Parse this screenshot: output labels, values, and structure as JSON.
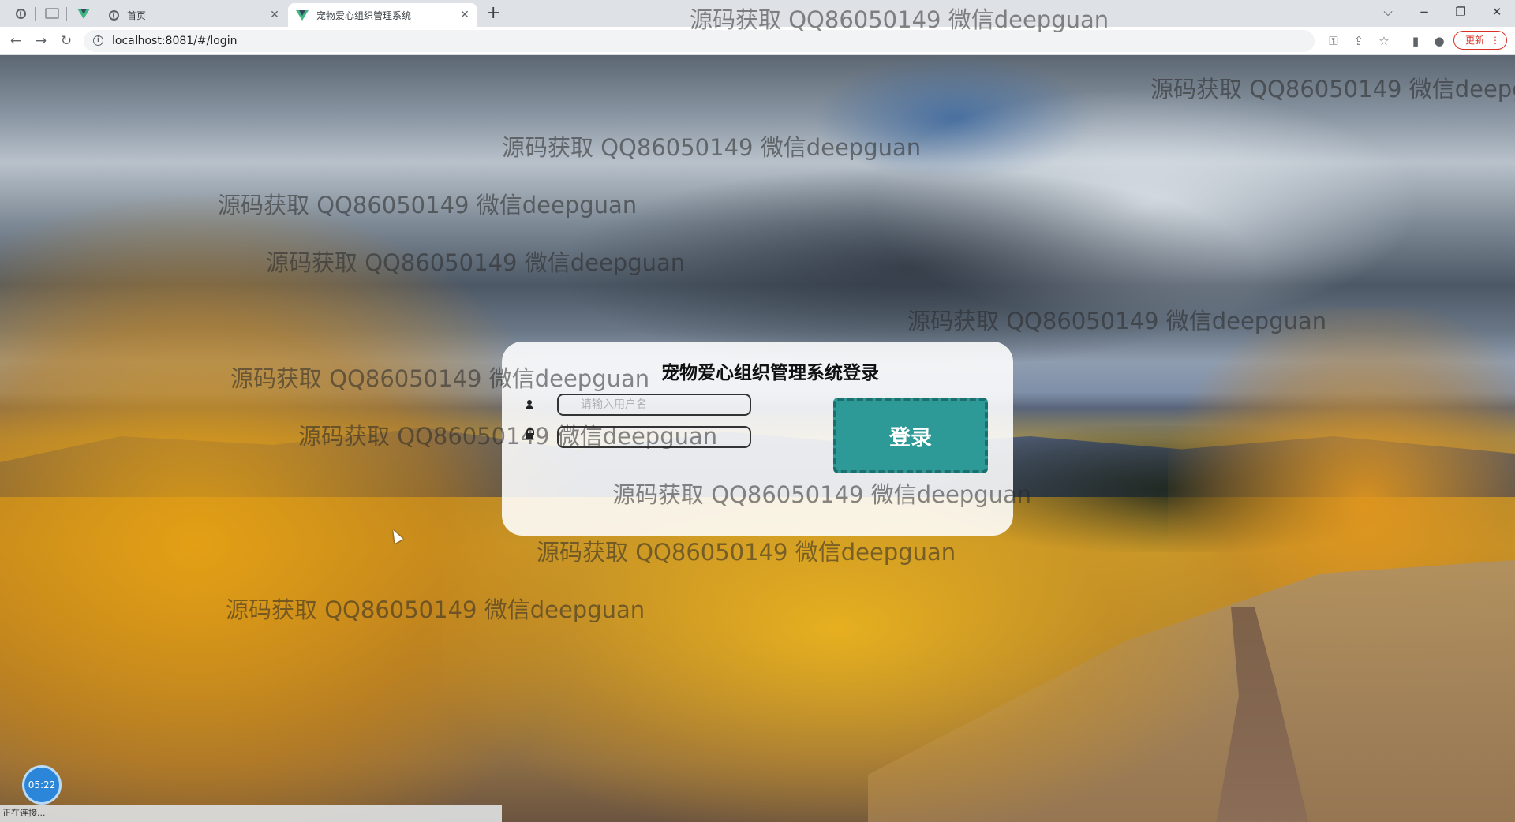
{
  "browser": {
    "tabs": [
      {
        "title": "首页"
      },
      {
        "title": "宠物爱心组织管理系统"
      }
    ],
    "new_tab": "+",
    "url": "localhost:8081/#/login",
    "update_label": "更新",
    "update_dots": "⋮",
    "icons": [
      "back-arrow-icon",
      "forward-arrow-icon",
      "reload-icon",
      "info-icon",
      "key-icon",
      "share-icon",
      "star-icon",
      "sidepanel-icon",
      "profile-icon"
    ]
  },
  "login": {
    "title": "宠物爱心组织管理系统登录",
    "username_placeholder": "请输入用户名",
    "password_placeholder": "",
    "button_label": "登录"
  },
  "watermark_text": "源码获取 QQ86050149 微信deepguan",
  "timer": "05:22",
  "status_text": "正在连接..."
}
